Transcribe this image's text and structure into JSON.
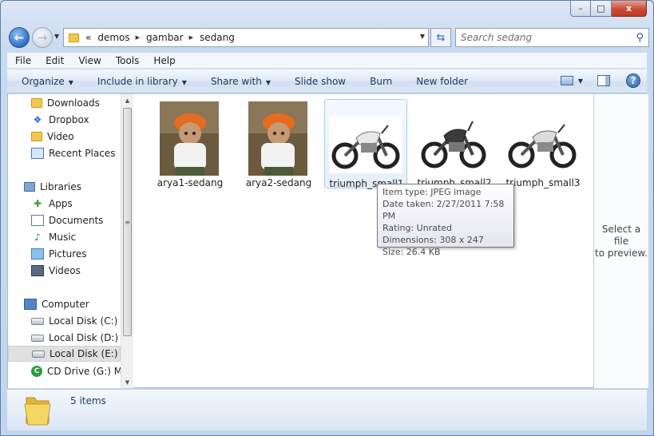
{
  "window": {
    "minimize_label": "–",
    "maximize_label": "□",
    "close_label": "x"
  },
  "address_bar": {
    "overflow": "«",
    "segments": [
      "demos",
      "gambar",
      "sedang"
    ]
  },
  "search": {
    "placeholder": "Search sedang"
  },
  "menu": [
    "File",
    "Edit",
    "View",
    "Tools",
    "Help"
  ],
  "toolbar": {
    "organize": "Organize",
    "include_in_library": "Include in library",
    "share_with": "Share with",
    "slide_show": "Slide show",
    "burn": "Burn",
    "new_folder": "New folder"
  },
  "nav": {
    "favorites": [
      {
        "label": "Downloads",
        "icon": "downloads-folder-icon"
      },
      {
        "label": "Dropbox",
        "icon": "dropbox-icon"
      },
      {
        "label": "Video",
        "icon": "folder-icon"
      },
      {
        "label": "Recent Places",
        "icon": "recent-places-icon"
      }
    ],
    "libraries_label": "Libraries",
    "libraries": [
      {
        "label": "Apps",
        "icon": "apps-library-icon"
      },
      {
        "label": "Documents",
        "icon": "documents-icon"
      },
      {
        "label": "Music",
        "icon": "music-icon"
      },
      {
        "label": "Pictures",
        "icon": "pictures-icon"
      },
      {
        "label": "Videos",
        "icon": "videos-icon"
      }
    ],
    "computer_label": "Computer",
    "drives": [
      {
        "label": "Local Disk (C:)",
        "icon": "system-drive-icon"
      },
      {
        "label": "Local Disk (D:)",
        "icon": "drive-icon"
      },
      {
        "label": "Local Disk (E:)",
        "icon": "drive-icon",
        "selected": true
      },
      {
        "label": "CD Drive (G:) MC",
        "icon": "cd-drive-icon"
      }
    ]
  },
  "files": [
    {
      "name": "arya1-sedang",
      "type": "photo"
    },
    {
      "name": "arya2-sedang",
      "type": "photo"
    },
    {
      "name": "triumph_small1",
      "type": "motorcycle"
    },
    {
      "name": "triumph_small2",
      "type": "motorcycle"
    },
    {
      "name": "triumph_small3",
      "type": "motorcycle"
    }
  ],
  "tooltip": {
    "item_type": "Item type: JPEG image",
    "date_taken": "Date taken: 2/27/2011 7:58 PM",
    "rating": "Rating: Unrated",
    "dimensions": "Dimensions: 308 x 247",
    "size": "Size: 26.4 KB"
  },
  "preview_pane": {
    "text_line1": "Select a file",
    "text_line2": "to preview."
  },
  "status": {
    "item_count": "5 items"
  },
  "colors": {
    "accent": "#1e395b",
    "chrome": "#c9dbf0",
    "hover": "#e4f0fd"
  }
}
